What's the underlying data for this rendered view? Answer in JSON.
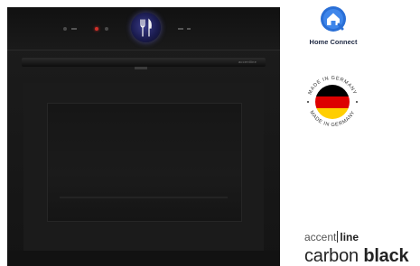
{
  "oven": {
    "model_label": "accentline",
    "display_icon": "cutlery-icon"
  },
  "home_connect": {
    "icon": "home-connect-icon",
    "label": "Home Connect",
    "brand_color": "#2a6fd6"
  },
  "badge": {
    "top_text": "MADE IN GERMANY",
    "bottom_text": "MADE IN GERMANY",
    "flag_colors": [
      "#000000",
      "#dd0000",
      "#ffce00"
    ]
  },
  "product_line": {
    "prefix": "accent",
    "suffix": "line"
  },
  "finish": {
    "regular": "carbon",
    "bold": "black"
  }
}
